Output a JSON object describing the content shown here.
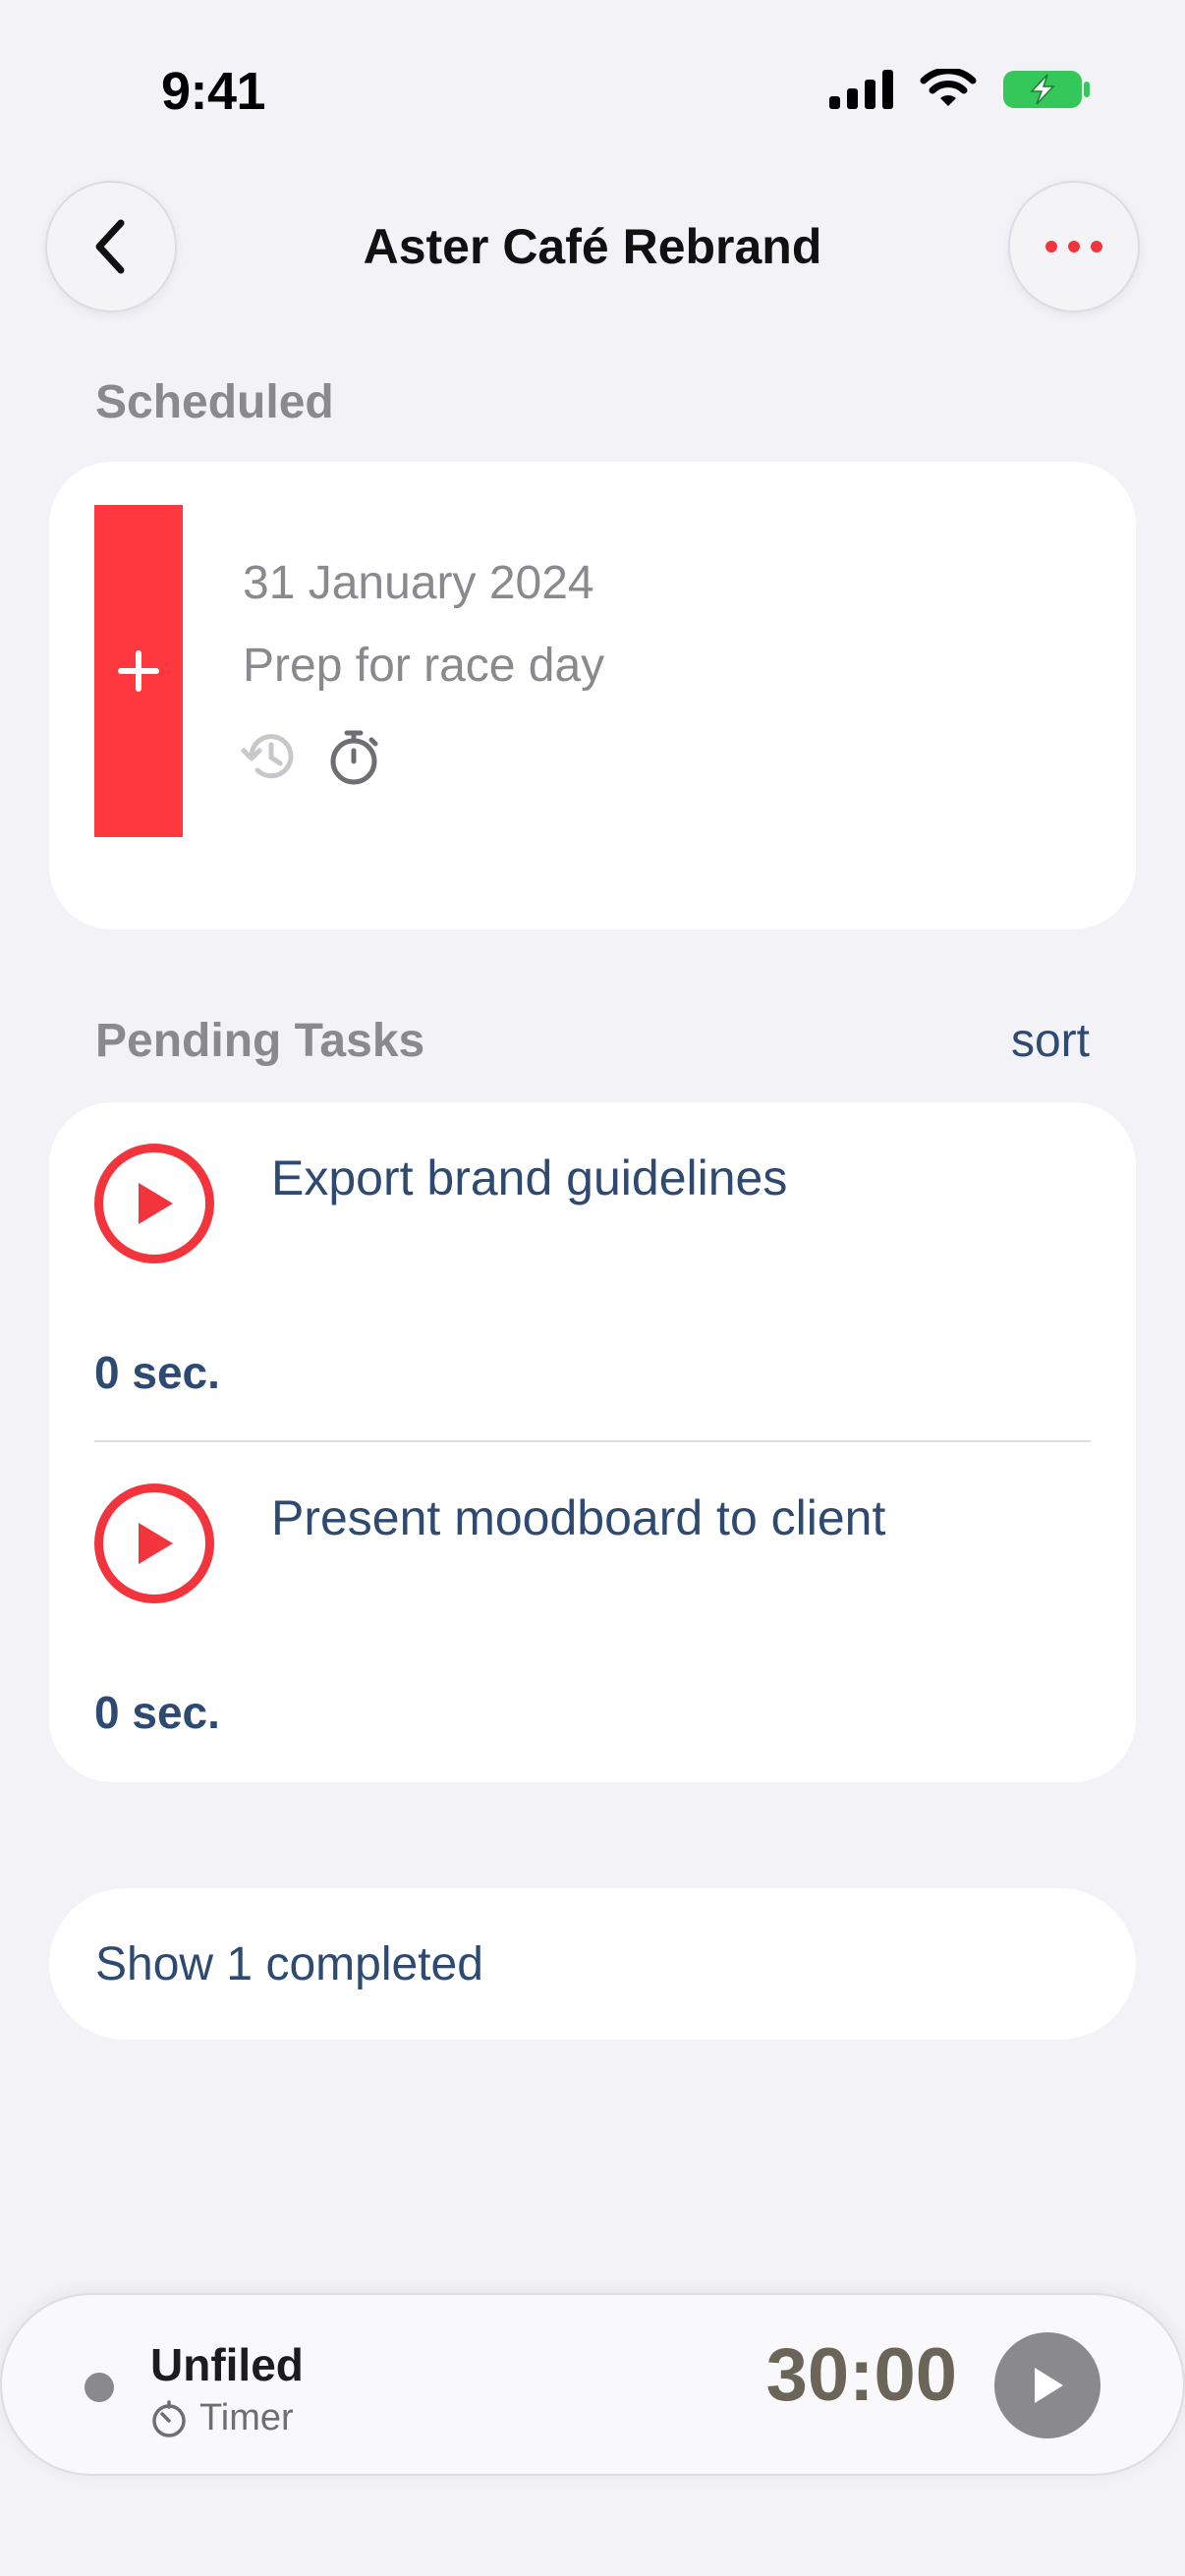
{
  "status": {
    "time": "9:41"
  },
  "nav": {
    "title": "Aster Café Rebrand"
  },
  "scheduled": {
    "header": "Scheduled",
    "date": "31 January 2024",
    "name": "Prep for race day",
    "accent_color": "#FF373E"
  },
  "pending": {
    "header": "Pending Tasks",
    "sort_label": "sort",
    "tasks": [
      {
        "title": "Export brand guidelines",
        "duration": "0 sec."
      },
      {
        "title": "Present moodboard to client",
        "duration": "0 sec."
      }
    ]
  },
  "completed": {
    "label": "Show 1 completed"
  },
  "timer": {
    "project": "Unfiled",
    "mode_label": "Timer",
    "time": "30:00"
  }
}
